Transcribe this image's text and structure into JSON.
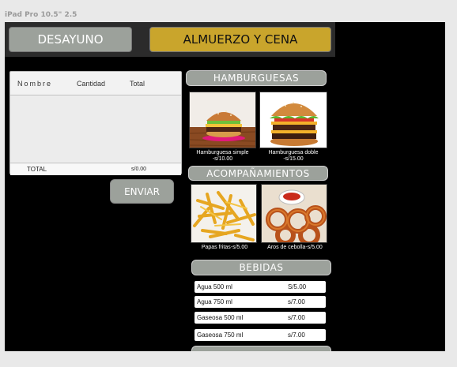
{
  "device": {
    "label": "iPad Pro 10.5\" 2.5"
  },
  "tabs": {
    "breakfast": "DESAYUNO",
    "lunch_dinner": "ALMUERZO Y CENA"
  },
  "order": {
    "col_name": "Nombre",
    "col_qty": "Cantidad",
    "col_total": "Total",
    "total_label": "TOTAL",
    "total_value": "s/0.00",
    "send_label": "ENVIAR"
  },
  "sections": {
    "burgers": "HAMBURGUESAS",
    "sides": "ACOMPAÑAMIENTOS",
    "drinks": "BEBIDAS"
  },
  "burgers": [
    {
      "line1": "Hamburguesa simple",
      "line2": "-s/10.00"
    },
    {
      "line1": "Hamburguesa doble",
      "line2": "-s/15.00"
    }
  ],
  "sides": [
    {
      "line1": "Papas fritas-s/5.00"
    },
    {
      "line1": "Aros de cebolla-s/5.00"
    }
  ],
  "drinks": [
    {
      "name": "Agua 500 ml",
      "price": "S/5.00"
    },
    {
      "name": "Agua 750 ml",
      "price": "s/7.00"
    },
    {
      "name": "Gaseosa 500 ml",
      "price": "s/7.00"
    },
    {
      "name": "Gaseosa 750 ml",
      "price": "s/7.00"
    }
  ],
  "colors": {
    "accent": "#c9a52c",
    "pill": "#9ca19b",
    "screen": "#000000"
  }
}
